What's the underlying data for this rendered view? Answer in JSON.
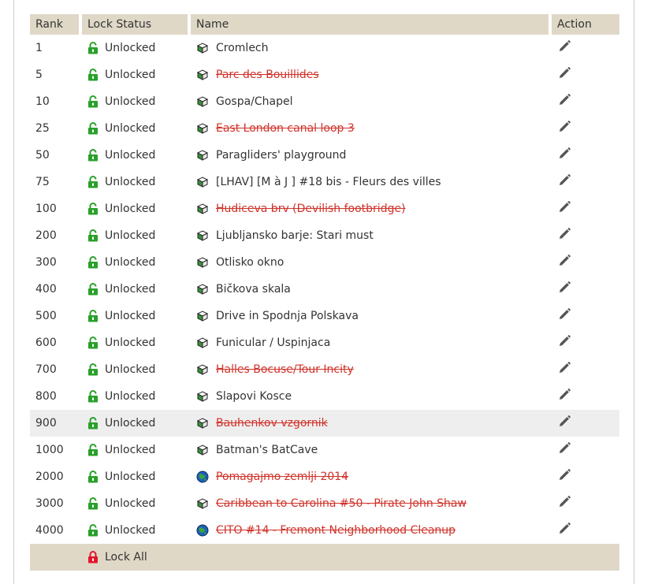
{
  "table": {
    "headers": {
      "rank": "Rank",
      "lock_status": "Lock Status",
      "name": "Name",
      "action": "Action"
    },
    "rows": [
      {
        "rank": "1",
        "status": "Unlocked",
        "name": "Cromlech",
        "archived": false,
        "type": "traditional-cache-icon"
      },
      {
        "rank": "5",
        "status": "Unlocked",
        "name": "Parc des Bouillides",
        "archived": true,
        "type": "traditional-cache-icon"
      },
      {
        "rank": "10",
        "status": "Unlocked",
        "name": "Gospa/Chapel",
        "archived": false,
        "type": "traditional-cache-icon"
      },
      {
        "rank": "25",
        "status": "Unlocked",
        "name": "East London canal loop 3",
        "archived": true,
        "type": "traditional-cache-icon"
      },
      {
        "rank": "50",
        "status": "Unlocked",
        "name": "Paragliders' playground",
        "archived": false,
        "type": "traditional-cache-icon"
      },
      {
        "rank": "75",
        "status": "Unlocked",
        "name": "[LHAV] [M à J ] #18 bis - Fleurs des villes",
        "archived": false,
        "type": "traditional-cache-icon"
      },
      {
        "rank": "100",
        "status": "Unlocked",
        "name": "Hudiceva brv (Devilish footbridge)",
        "archived": true,
        "type": "traditional-cache-icon"
      },
      {
        "rank": "200",
        "status": "Unlocked",
        "name": "Ljubljansko barje: Stari must",
        "archived": false,
        "type": "traditional-cache-icon"
      },
      {
        "rank": "300",
        "status": "Unlocked",
        "name": "Otlisko okno",
        "archived": false,
        "type": "traditional-cache-icon"
      },
      {
        "rank": "400",
        "status": "Unlocked",
        "name": "Bičkova skala",
        "archived": false,
        "type": "traditional-cache-icon"
      },
      {
        "rank": "500",
        "status": "Unlocked",
        "name": "Drive in Spodnja Polskava",
        "archived": false,
        "type": "traditional-cache-icon"
      },
      {
        "rank": "600",
        "status": "Unlocked",
        "name": "Funicular / Uspinjaca",
        "archived": false,
        "type": "traditional-cache-icon"
      },
      {
        "rank": "700",
        "status": "Unlocked",
        "name": "Halles Bocuse/Tour Incity",
        "archived": true,
        "type": "traditional-cache-icon"
      },
      {
        "rank": "800",
        "status": "Unlocked",
        "name": "Slapovi Kosce",
        "archived": false,
        "type": "traditional-cache-icon"
      },
      {
        "rank": "900",
        "status": "Unlocked",
        "name": "Bauhenkov vzgornik",
        "archived": true,
        "type": "traditional-cache-icon",
        "hover": true
      },
      {
        "rank": "1000",
        "status": "Unlocked",
        "name": "Batman's BatCave",
        "archived": false,
        "type": "traditional-cache-icon"
      },
      {
        "rank": "2000",
        "status": "Unlocked",
        "name": "Pomagajmo zemlji 2014",
        "archived": true,
        "type": "cito-event-icon"
      },
      {
        "rank": "3000",
        "status": "Unlocked",
        "name": "Caribbean to Carolina #50 - Pirate John Shaw",
        "archived": true,
        "type": "traditional-cache-icon"
      },
      {
        "rank": "4000",
        "status": "Unlocked",
        "name": "CITO #14 - Fremont Neighborhood Cleanup",
        "archived": true,
        "type": "cito-event-icon"
      }
    ],
    "footer": {
      "lock_all_label": "Lock All"
    }
  },
  "colors": {
    "header_bg": "#e0d8c7",
    "unlocked_green": "#2aa02a",
    "locked_red": "#e3162b",
    "archived_red": "#d0322a"
  }
}
